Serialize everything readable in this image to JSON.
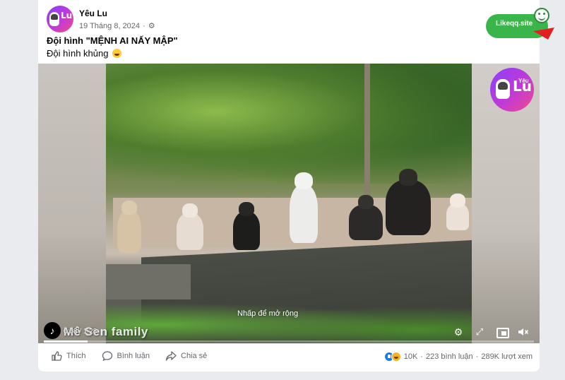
{
  "post": {
    "author": "Yêu Lu",
    "date": "19 Tháng 8, 2024",
    "privacy_icon": "gear-icon",
    "caption_line1": "Đội hình \"MỆNH AI NẤY MẬP\"",
    "caption_line2": "Đội hình khủng",
    "caption_emoji": "laughing-emoji"
  },
  "avatar": {
    "brand": "Lu"
  },
  "overlay_ad": {
    "label": "Likeqq.site"
  },
  "video": {
    "logo_text": "Lu",
    "logo_small": "Yêu",
    "expand_hint": "Nhấp để mở rộng",
    "watermark": "Mê Sen family",
    "time": "0:08 / 1:28",
    "progress_fraction": 0.09
  },
  "actions": {
    "like_label": "Thích",
    "comment_label": "Bình luận",
    "share_label": "Chia sẻ"
  },
  "stats": {
    "reactions": "10K",
    "comments": "223 bình luận",
    "views": "289K lượt xem",
    "separator": "·"
  },
  "colors": {
    "accent": "#1877f2",
    "ad_green": "#3ab54a",
    "brand_gradient_start": "#8a3ffc",
    "brand_gradient_end": "#ef4b8a"
  }
}
